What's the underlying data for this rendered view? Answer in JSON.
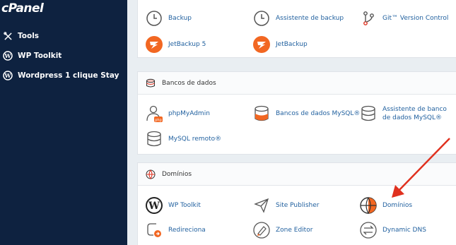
{
  "sidebar": {
    "logo": "cPanel",
    "items": [
      {
        "label": "Tools"
      },
      {
        "label": "WP Toolkit"
      },
      {
        "label": "Wordpress 1 clique Stay"
      }
    ]
  },
  "files_section": {
    "tools": [
      {
        "label": "Backup"
      },
      {
        "label": "Assistente de backup"
      },
      {
        "label": "Git™ Version Control"
      },
      {
        "label": "JetBackup 5"
      },
      {
        "label": "JetBackup"
      }
    ]
  },
  "databases_section": {
    "title": "Bancos de dados",
    "tools": [
      {
        "label": "phpMyAdmin"
      },
      {
        "label": "Bancos de dados MySQL®"
      },
      {
        "label": "Assistente de banco de dados MySQL®"
      },
      {
        "label": "MySQL remoto®"
      }
    ]
  },
  "domains_section": {
    "title": "Domínios",
    "tools": [
      {
        "label": "WP Toolkit"
      },
      {
        "label": "Site Publisher"
      },
      {
        "label": "Domínios"
      },
      {
        "label": "Redireciona"
      },
      {
        "label": "Zone Editor"
      },
      {
        "label": "Dynamic DNS"
      }
    ]
  },
  "colors": {
    "sidebar_bg": "#0e2240",
    "link": "#1f5f9e",
    "jetbackup_orange": "#f26722",
    "arrow_red": "#e0311f"
  }
}
